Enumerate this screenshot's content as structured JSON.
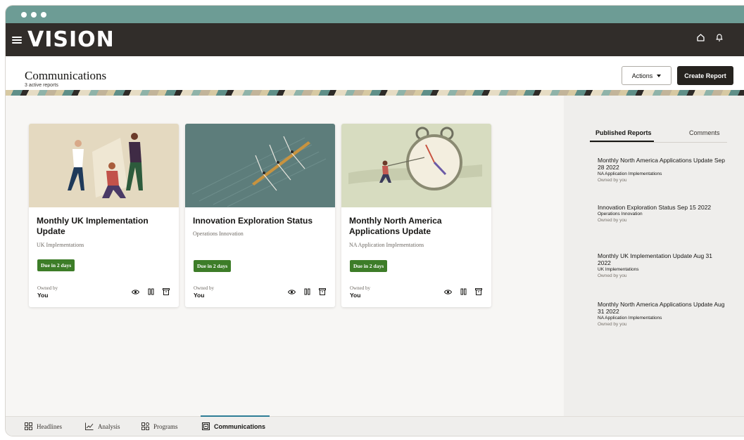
{
  "app": {
    "brand": "VISION"
  },
  "page": {
    "title": "Communications",
    "subtitle": "3 active reports"
  },
  "toolbar": {
    "actions_label": "Actions",
    "create_label": "Create Report"
  },
  "cards": [
    {
      "title": "Monthly UK Implementation Update",
      "subtitle": "UK Implementations",
      "badge": "Due in 2 days",
      "owned_label": "Owned by",
      "owner": "You"
    },
    {
      "title": "Innovation Exploration Status",
      "subtitle": "Operations Innovation",
      "badge": "Due in 2 days",
      "owned_label": "Owned by",
      "owner": "You"
    },
    {
      "title": "Monthly North America Applications Update",
      "subtitle": "NA Application Implementations",
      "badge": "Due in 2 days",
      "owned_label": "Owned by",
      "owner": "You"
    }
  ],
  "sidebar": {
    "tabs": [
      "Published Reports",
      "Comments"
    ],
    "reports": [
      {
        "title": "Monthly North America Applications Update Sep 28 2022",
        "group": "NA Application Implementations",
        "owner": "Owned by you"
      },
      {
        "title": "Innovation Exploration Status Sep 15 2022",
        "group": "Operations Innovation",
        "owner": "Owned by you"
      },
      {
        "title": "Monthly UK Implementation Update Aug 31 2022",
        "group": "UK Implementations",
        "owner": "Owned by you"
      },
      {
        "title": "Monthly North America Applications Update Aug 31 2022",
        "group": "NA Application Implementations",
        "owner": "Owned by you"
      }
    ]
  },
  "bottom_nav": [
    {
      "label": "Headlines",
      "icon": "headlines-icon"
    },
    {
      "label": "Analysis",
      "icon": "analysis-icon"
    },
    {
      "label": "Programs",
      "icon": "programs-icon"
    },
    {
      "label": "Communications",
      "icon": "communications-icon",
      "active": true
    }
  ],
  "colors": {
    "chrome": "#6d9c95",
    "appbar": "#312d2a",
    "badge": "#3d7d28",
    "primary_button": "#26231f",
    "active_tab_accent": "#2e7d96"
  }
}
